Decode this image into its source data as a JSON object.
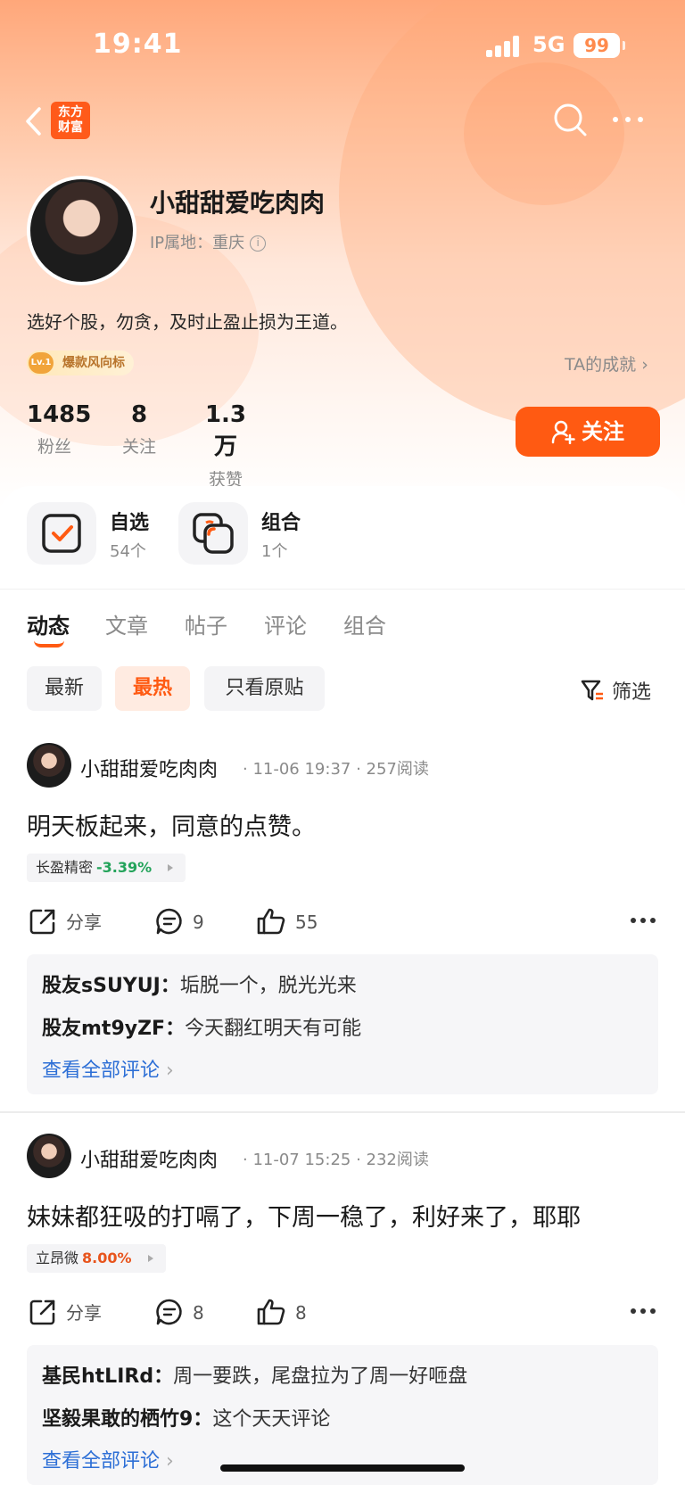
{
  "status_bar": {
    "time": "19:41",
    "network": "5G",
    "battery": "99"
  },
  "nav": {
    "logo_text": "东方\n财富",
    "logo_line1": "东方",
    "logo_line2": "财富"
  },
  "profile": {
    "username": "小甜甜爱吃肉肉",
    "ip_location": "IP属地：重庆",
    "bio": "选好个股，勿贪，及时止盈止损为王道。",
    "badge_level": "Lv.1",
    "badge": "爆款风向标",
    "achievement_link": "TA的成就",
    "stats": [
      {
        "value": "1485",
        "label": "粉丝"
      },
      {
        "value": "8",
        "label": "关注"
      },
      {
        "value": "1.3万",
        "label": "获赞"
      }
    ],
    "follow_button": "关注"
  },
  "collections": [
    {
      "title": "自选",
      "count": "54个",
      "icon": "checkbox-icon"
    },
    {
      "title": "组合",
      "count": "1个",
      "icon": "portfolio-icon"
    }
  ],
  "tabs": [
    {
      "label": "动态",
      "active": true
    },
    {
      "label": "文章",
      "active": false
    },
    {
      "label": "帖子",
      "active": false
    },
    {
      "label": "评论",
      "active": false
    },
    {
      "label": "组合",
      "active": false
    }
  ],
  "filters": {
    "chips": [
      {
        "label": "最新",
        "active": false
      },
      {
        "label": "最热",
        "active": true
      },
      {
        "label": "只看原贴",
        "active": false
      }
    ],
    "filter_label": "筛选"
  },
  "colors": {
    "accent": "#ff5a12",
    "up": "#e8541c",
    "down": "#23a35a",
    "link": "#2d6fd6"
  },
  "posts": [
    {
      "author": "小甜甜爱吃肉肉",
      "time": "11-06 19:37",
      "reads": "257阅读",
      "text": "明天板起来，同意的点赞。",
      "stock": {
        "name": "长盈精密",
        "change": "-3.39%"
      },
      "share": "分享",
      "comments": "9",
      "likes": "55",
      "comment_preview": [
        {
          "user": "股友sSUYUJ：",
          "text": "垢脱一个，脱光光来"
        },
        {
          "user": "股友mt9yZF：",
          "text": "今天翻红明天有可能"
        }
      ],
      "view_all": "查看全部评论"
    },
    {
      "author": "小甜甜爱吃肉肉",
      "time": "11-07 15:25",
      "reads": "232阅读",
      "text": "妹妹都狂吸的打嗝了，下周一稳了，利好来了，耶耶",
      "stock": {
        "name": "立昂微",
        "change": "8.00%"
      },
      "share": "分享",
      "comments": "8",
      "likes": "8",
      "comment_preview": [
        {
          "user": "基民htLIRd：",
          "text": "周一要跌，尾盘拉为了周一好咂盘"
        },
        {
          "user": "坚毅果敢的栖竹9：",
          "text": "这个天天评论"
        }
      ],
      "view_all": "查看全部评论"
    }
  ]
}
